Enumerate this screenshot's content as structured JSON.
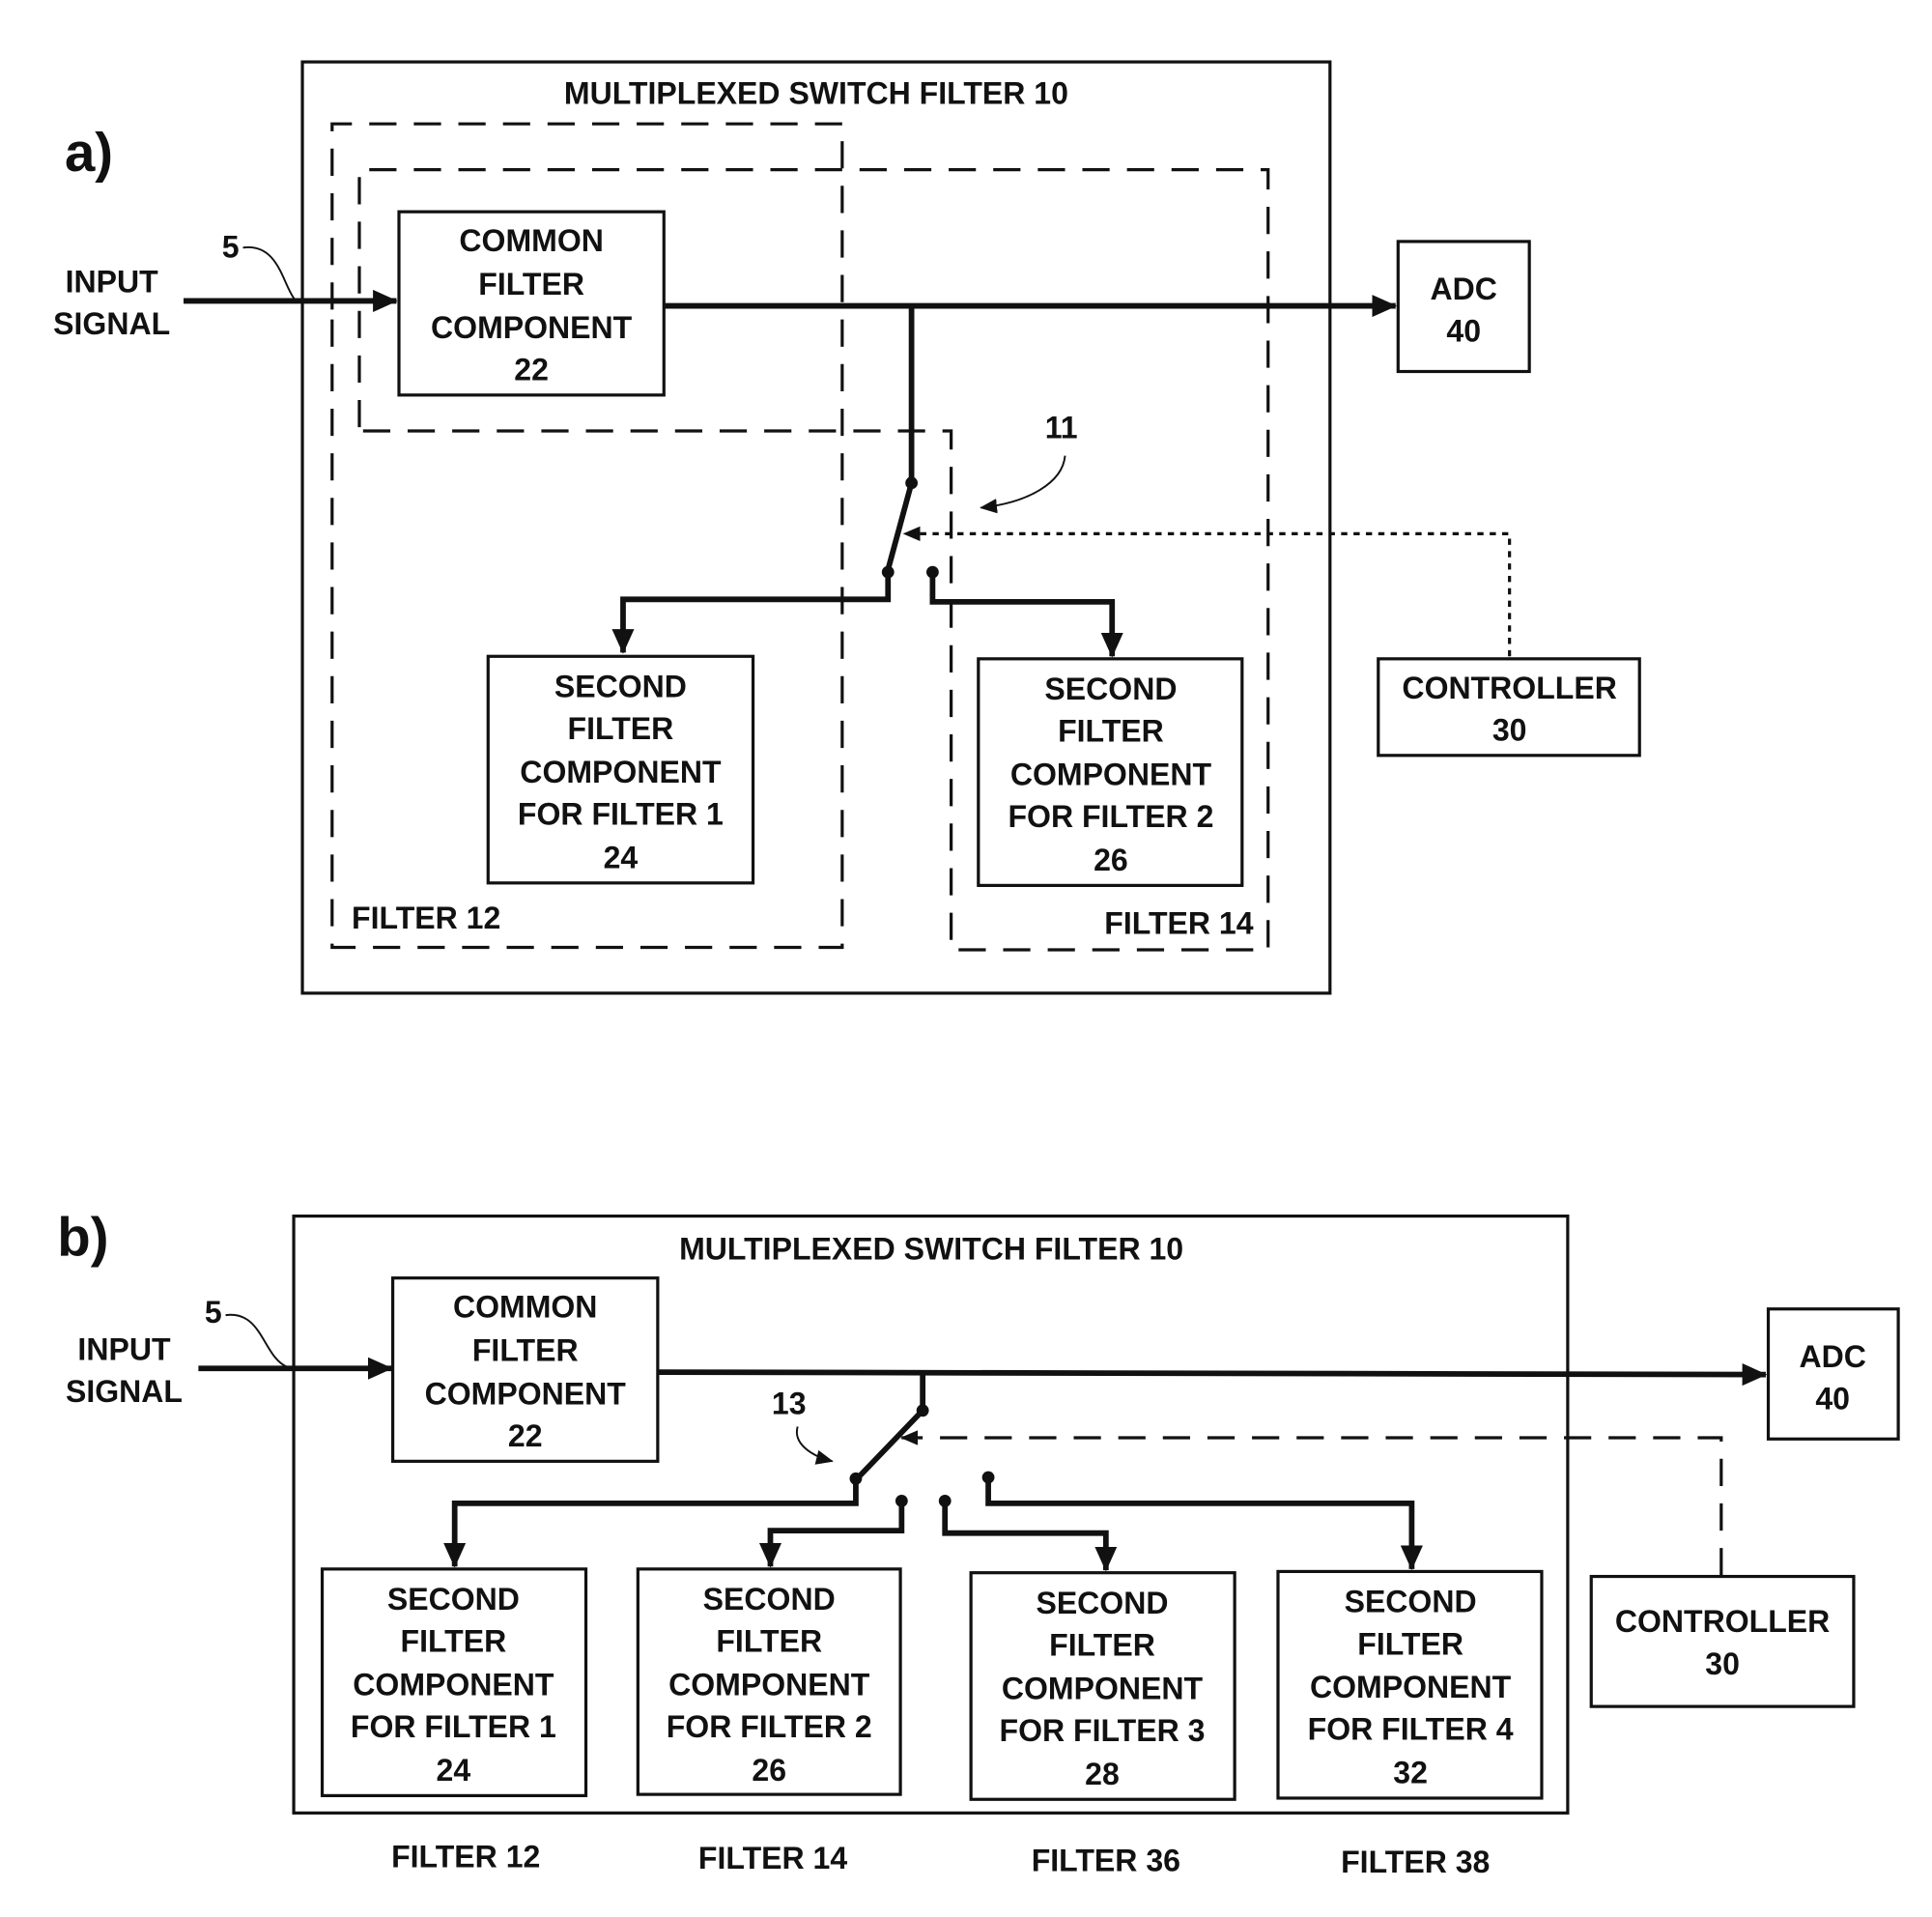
{
  "panel_a": {
    "label": "a)",
    "title": "MULTIPLEXED SWITCH FILTER 10",
    "input": [
      "INPUT",
      "SIGNAL"
    ],
    "input_ref": "5",
    "switch_ref": "11",
    "common": [
      "COMMON",
      "FILTER",
      "COMPONENT",
      "22"
    ],
    "adc": [
      "ADC",
      "40"
    ],
    "controller": [
      "CONTROLLER",
      "30"
    ],
    "second": [
      [
        "SECOND",
        "FILTER",
        "COMPONENT",
        "FOR FILTER 1",
        "24"
      ],
      [
        "SECOND",
        "FILTER",
        "COMPONENT",
        "FOR FILTER 2",
        "26"
      ]
    ],
    "filter_groups": [
      "FILTER 12",
      "FILTER 14"
    ]
  },
  "panel_b": {
    "label": "b)",
    "title": "MULTIPLEXED SWITCH FILTER 10",
    "input": [
      "INPUT",
      "SIGNAL"
    ],
    "input_ref": "5",
    "switch_ref": "13",
    "common": [
      "COMMON",
      "FILTER",
      "COMPONENT",
      "22"
    ],
    "adc": [
      "ADC",
      "40"
    ],
    "controller": [
      "CONTROLLER",
      "30"
    ],
    "second": [
      [
        "SECOND",
        "FILTER",
        "COMPONENT",
        "FOR FILTER 1",
        "24"
      ],
      [
        "SECOND",
        "FILTER",
        "COMPONENT",
        "FOR FILTER 2",
        "26"
      ],
      [
        "SECOND",
        "FILTER",
        "COMPONENT",
        "FOR FILTER 3",
        "28"
      ],
      [
        "SECOND",
        "FILTER",
        "COMPONENT",
        "FOR FILTER 4",
        "32"
      ]
    ],
    "filter_groups": [
      "FILTER 12",
      "FILTER 14",
      "FILTER 36",
      "FILTER 38"
    ]
  }
}
